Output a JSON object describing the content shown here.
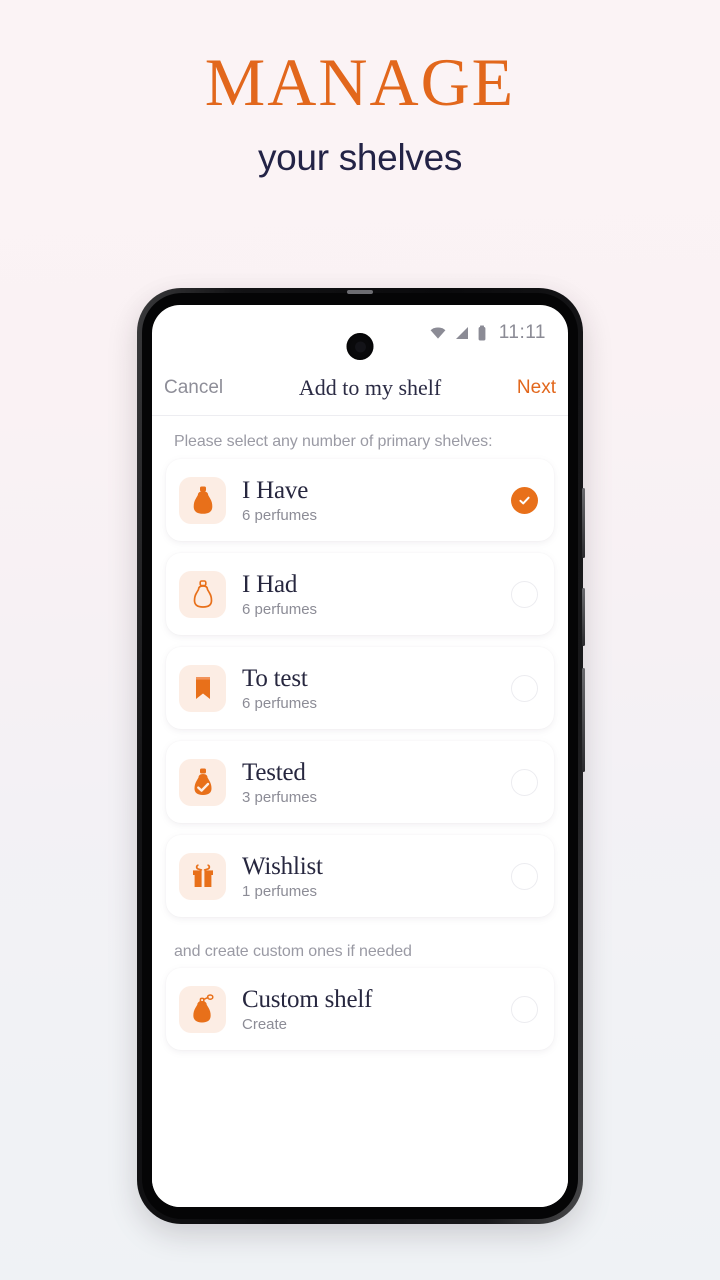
{
  "promo": {
    "title": "MANAGE",
    "subtitle": "your shelves",
    "title_color": "#E2671C",
    "subtitle_color": "#232346"
  },
  "phone": {
    "status_bar": {
      "time": "11:11",
      "icons": [
        "wifi-icon",
        "cellular-signal-icon",
        "battery-icon"
      ]
    },
    "nav": {
      "cancel_label": "Cancel",
      "title": "Add to my shelf",
      "next_label": "Next",
      "next_color": "#E2671C"
    },
    "primary_section_label": "Please select any number of primary shelves:",
    "custom_section_label": "and create custom ones if needed",
    "accent_color": "#E8701A",
    "tile_background": "#FCEDE4",
    "shelves": [
      {
        "title": "I Have",
        "subtitle": "6 perfumes",
        "icon": "perfume-bottle-filled-icon",
        "selected": true
      },
      {
        "title": "I Had",
        "subtitle": "6 perfumes",
        "icon": "perfume-bottle-outline-icon",
        "selected": false
      },
      {
        "title": "To test",
        "subtitle": "6 perfumes",
        "icon": "bookmark-icon",
        "selected": false
      },
      {
        "title": "Tested",
        "subtitle": "3 perfumes",
        "icon": "perfume-bottle-check-icon",
        "selected": false
      },
      {
        "title": "Wishlist",
        "subtitle": "1 perfumes",
        "icon": "gift-icon",
        "selected": false
      }
    ],
    "custom_shelves": [
      {
        "title": "Custom shelf",
        "subtitle": "Create",
        "icon": "perfume-atomizer-icon",
        "selected": false
      }
    ]
  }
}
